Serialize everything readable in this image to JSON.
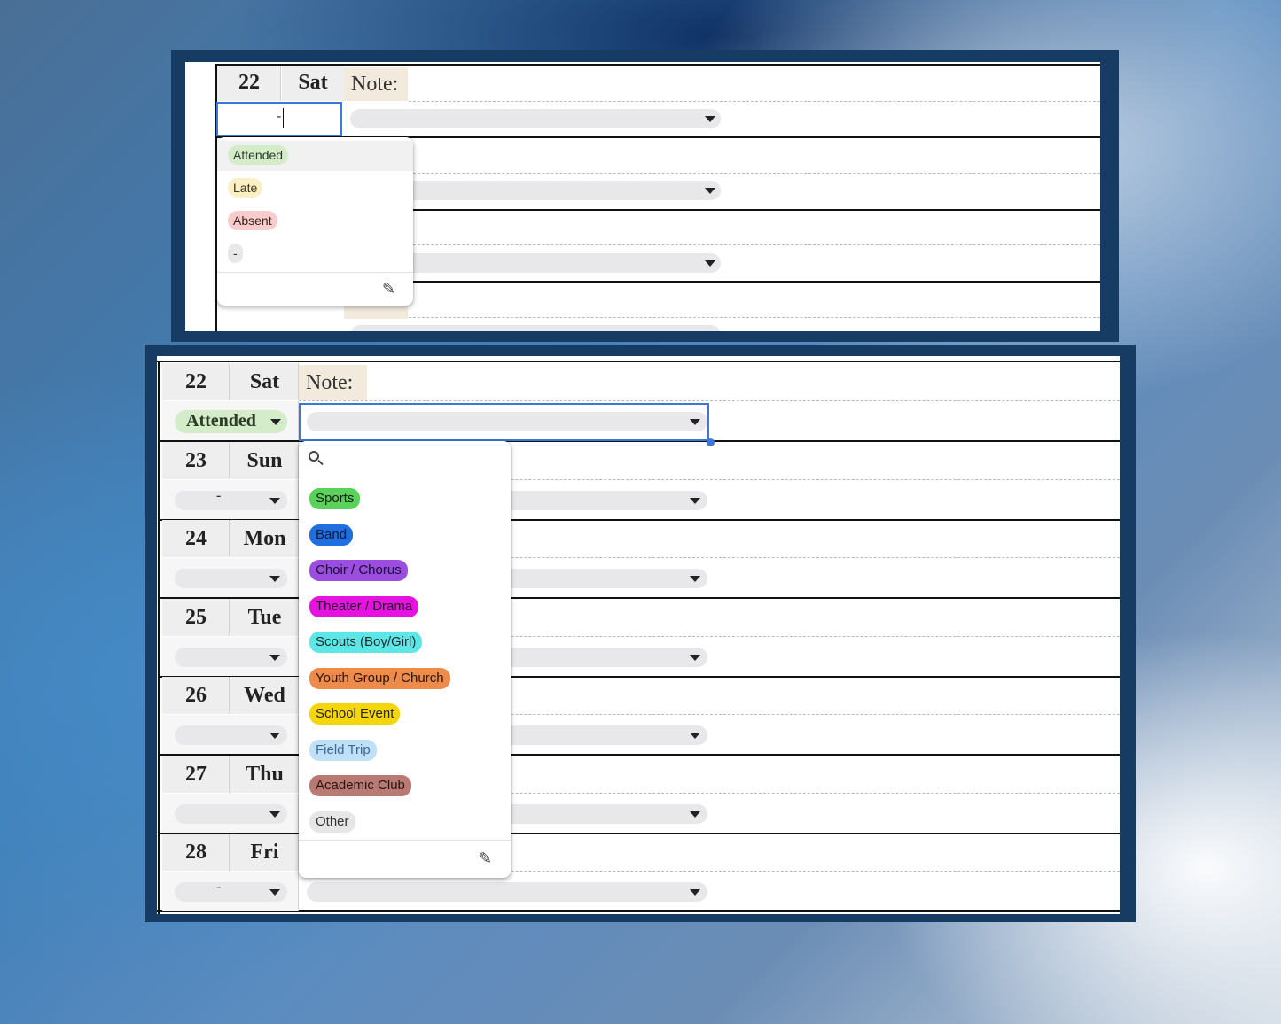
{
  "top_panel": {
    "day_number": "22",
    "day_name": "Sat",
    "note_label": "Note:",
    "status_input_value": "-",
    "status_options": [
      {
        "label": "Attended",
        "bg": "#d4ecc9"
      },
      {
        "label": "Late",
        "bg": "#fbefc4"
      },
      {
        "label": "Absent",
        "bg": "#f8cccc"
      },
      {
        "label": "-",
        "bg": "#e8e8e8"
      }
    ],
    "edit_icon": "pencil-icon"
  },
  "bottom_panel": {
    "rows": [
      {
        "num": "22",
        "day": "Sat",
        "status": "Attended"
      },
      {
        "num": "23",
        "day": "Sun",
        "status": "-"
      },
      {
        "num": "24",
        "day": "Mon",
        "status": ""
      },
      {
        "num": "25",
        "day": "Tue",
        "status": ""
      },
      {
        "num": "26",
        "day": "Wed",
        "status": ""
      },
      {
        "num": "27",
        "day": "Thu",
        "status": ""
      },
      {
        "num": "28",
        "day": "Fri",
        "status": "-"
      }
    ],
    "note_label": "Note:",
    "search_icon": "search-icon",
    "activity_options": [
      {
        "label": "Sports",
        "bg": "#5ad25a",
        "fg": "#1a1a1a"
      },
      {
        "label": "Band",
        "bg": "#1f6fe0",
        "fg": "#0d1c3a"
      },
      {
        "label": "Choir / Chorus",
        "bg": "#9b4de0",
        "fg": "#1a0d2e"
      },
      {
        "label": "Theater / Drama",
        "bg": "#e612e0",
        "fg": "#2a0a29"
      },
      {
        "label": "Scouts (Boy/Girl)",
        "bg": "#5de6e6",
        "fg": "#1a2b2b"
      },
      {
        "label": "Youth Group / Church",
        "bg": "#ee8a4a",
        "fg": "#2a1607"
      },
      {
        "label": "School Event",
        "bg": "#f3d60c",
        "fg": "#2a2200"
      },
      {
        "label": "Field Trip",
        "bg": "#bfe0f6",
        "fg": "#3a6a9a"
      },
      {
        "label": "Academic Club",
        "bg": "#b87a72",
        "fg": "#2a1412"
      },
      {
        "label": "Other",
        "bg": "#e6e6e6",
        "fg": "#333333"
      }
    ],
    "edit_icon": "pencil-icon"
  }
}
